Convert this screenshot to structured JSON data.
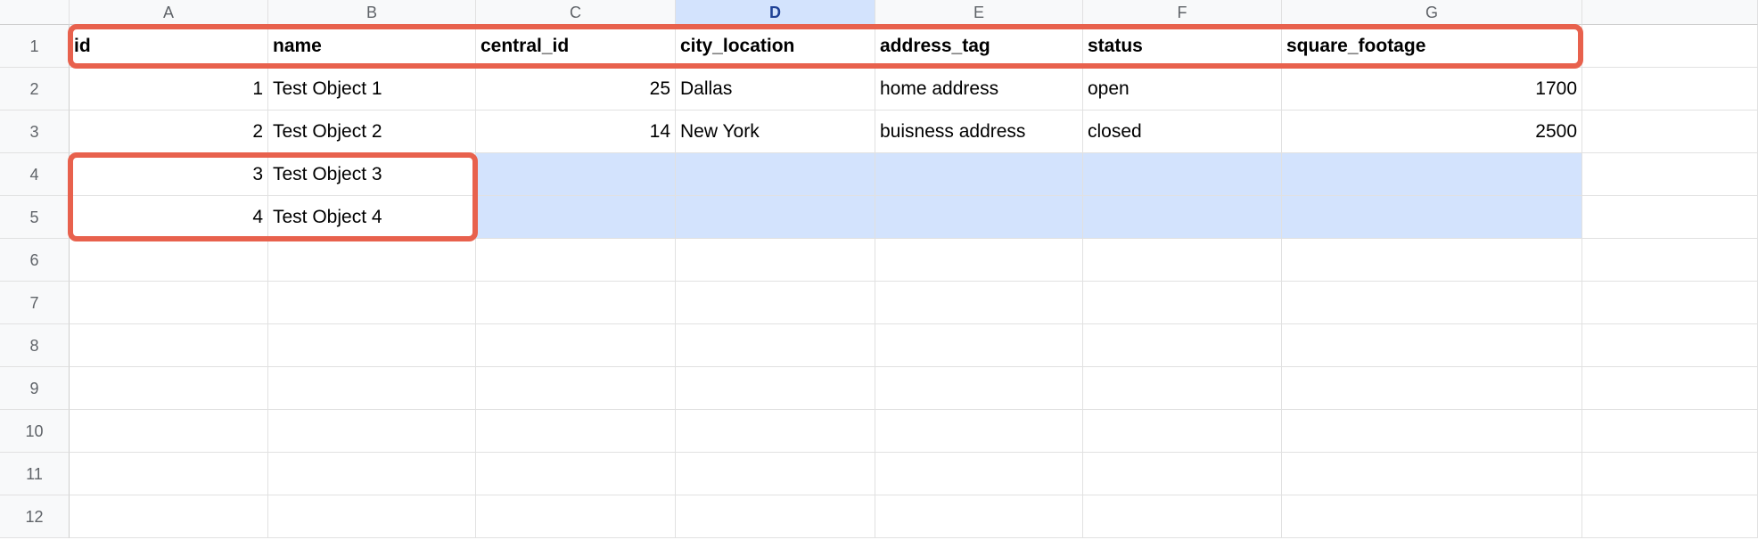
{
  "columns": [
    "A",
    "B",
    "C",
    "D",
    "E",
    "F",
    "G"
  ],
  "active_column": "D",
  "row_numbers": [
    "1",
    "2",
    "3",
    "4",
    "5",
    "6",
    "7",
    "8",
    "9",
    "10",
    "11",
    "12"
  ],
  "headers": {
    "A": "id",
    "B": "name",
    "C": "central_id",
    "D": "city_location",
    "E": "address_tag",
    "F": "status",
    "G": "square_footage"
  },
  "rows": [
    {
      "id": "1",
      "name": "Test Object 1",
      "central_id": "25",
      "city_location": "Dallas",
      "address_tag": "home address",
      "status": "open",
      "square_footage": "1700"
    },
    {
      "id": "2",
      "name": "Test Object 2",
      "central_id": "14",
      "city_location": "New York",
      "address_tag": "buisness address",
      "status": "closed",
      "square_footage": "2500"
    },
    {
      "id": "3",
      "name": "Test Object 3",
      "central_id": "",
      "city_location": "",
      "address_tag": "",
      "status": "",
      "square_footage": ""
    },
    {
      "id": "4",
      "name": "Test Object 4",
      "central_id": "",
      "city_location": "",
      "address_tag": "",
      "status": "",
      "square_footage": ""
    }
  ],
  "selection": {
    "rows": [
      4,
      5
    ],
    "cols": [
      "C",
      "D",
      "E",
      "F",
      "G"
    ]
  },
  "annotations": {
    "box1": "header-row",
    "box2": "rows-4-5-AB"
  }
}
